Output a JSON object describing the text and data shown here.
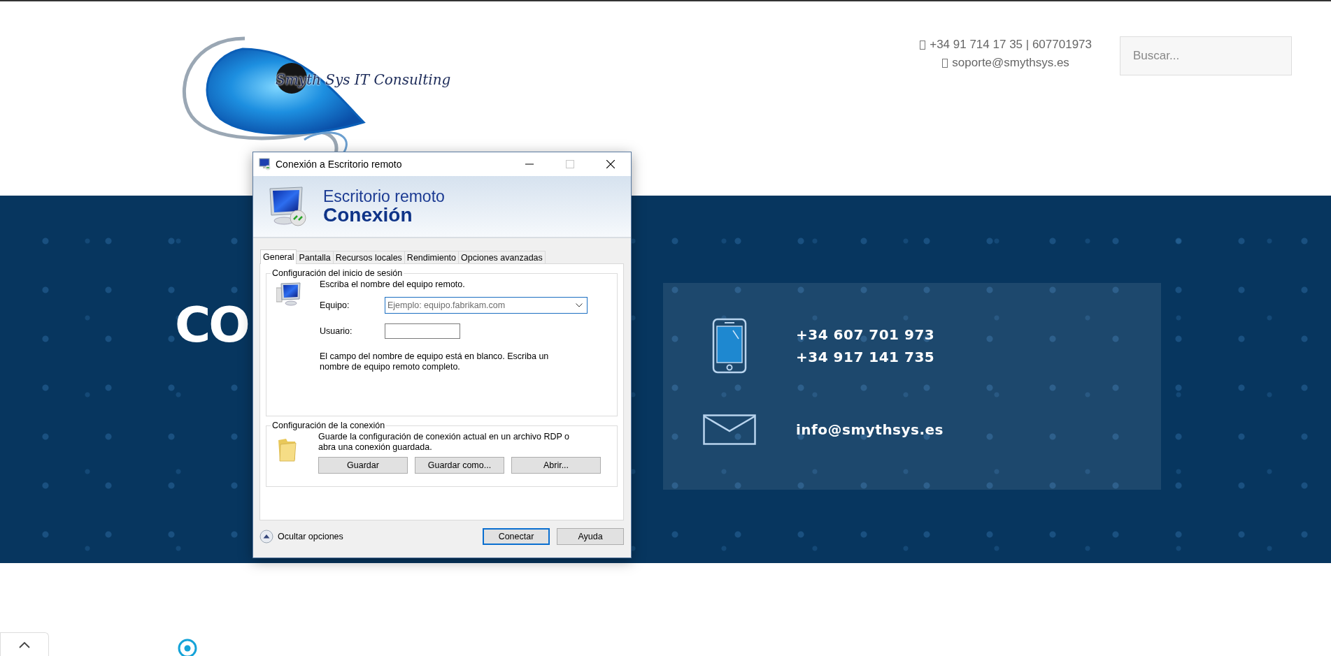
{
  "header": {
    "logo_text": "Smyth Sys IT Consulting",
    "phone": "+34 91 714 17 35 | 607701973",
    "email": "soporte@smythsys.es",
    "search": {
      "placeholder": "Buscar..."
    }
  },
  "hero": {
    "heading": "CO",
    "contact_card": {
      "phones": [
        "+34 607 701 973",
        "+34 917 141 735"
      ],
      "email": "info@smythsys.es"
    }
  },
  "dialog": {
    "title": "Conexión a Escritorio remoto",
    "window_controls": [
      {
        "kind": "minimize",
        "disabled": false
      },
      {
        "kind": "maximize",
        "disabled": true
      },
      {
        "kind": "close",
        "disabled": false
      }
    ],
    "banner": {
      "line1": "Escritorio remoto",
      "line2": "Conexión"
    },
    "tabs": [
      {
        "label": "General",
        "selected": true
      },
      {
        "label": "Pantalla",
        "selected": false
      },
      {
        "label": "Recursos locales",
        "selected": false
      },
      {
        "label": "Rendimiento",
        "selected": false
      },
      {
        "label": "Opciones avanzadas",
        "selected": false
      }
    ],
    "logon_group": {
      "title": "Configuración del inicio de sesión",
      "intro": "Escriba el nombre del equipo remoto.",
      "computer": {
        "label": "Equipo:",
        "placeholder": "Ejemplo: equipo.fabrikam.com"
      },
      "user": {
        "label": "Usuario:"
      },
      "note": "El campo del nombre de equipo está en blanco. Escriba un nombre de equipo remoto completo."
    },
    "connection_group": {
      "title": "Configuración de la conexión",
      "text": "Guarde la configuración de conexión actual en un archivo RDP o abra una conexión guardada.",
      "buttons": [
        "Guardar",
        "Guardar como...",
        "Abrir..."
      ]
    },
    "toggle": "Ocultar opciones",
    "buttons": [
      {
        "label": "Conectar",
        "default": true
      },
      {
        "label": "Ayuda",
        "default": false
      }
    ]
  }
}
